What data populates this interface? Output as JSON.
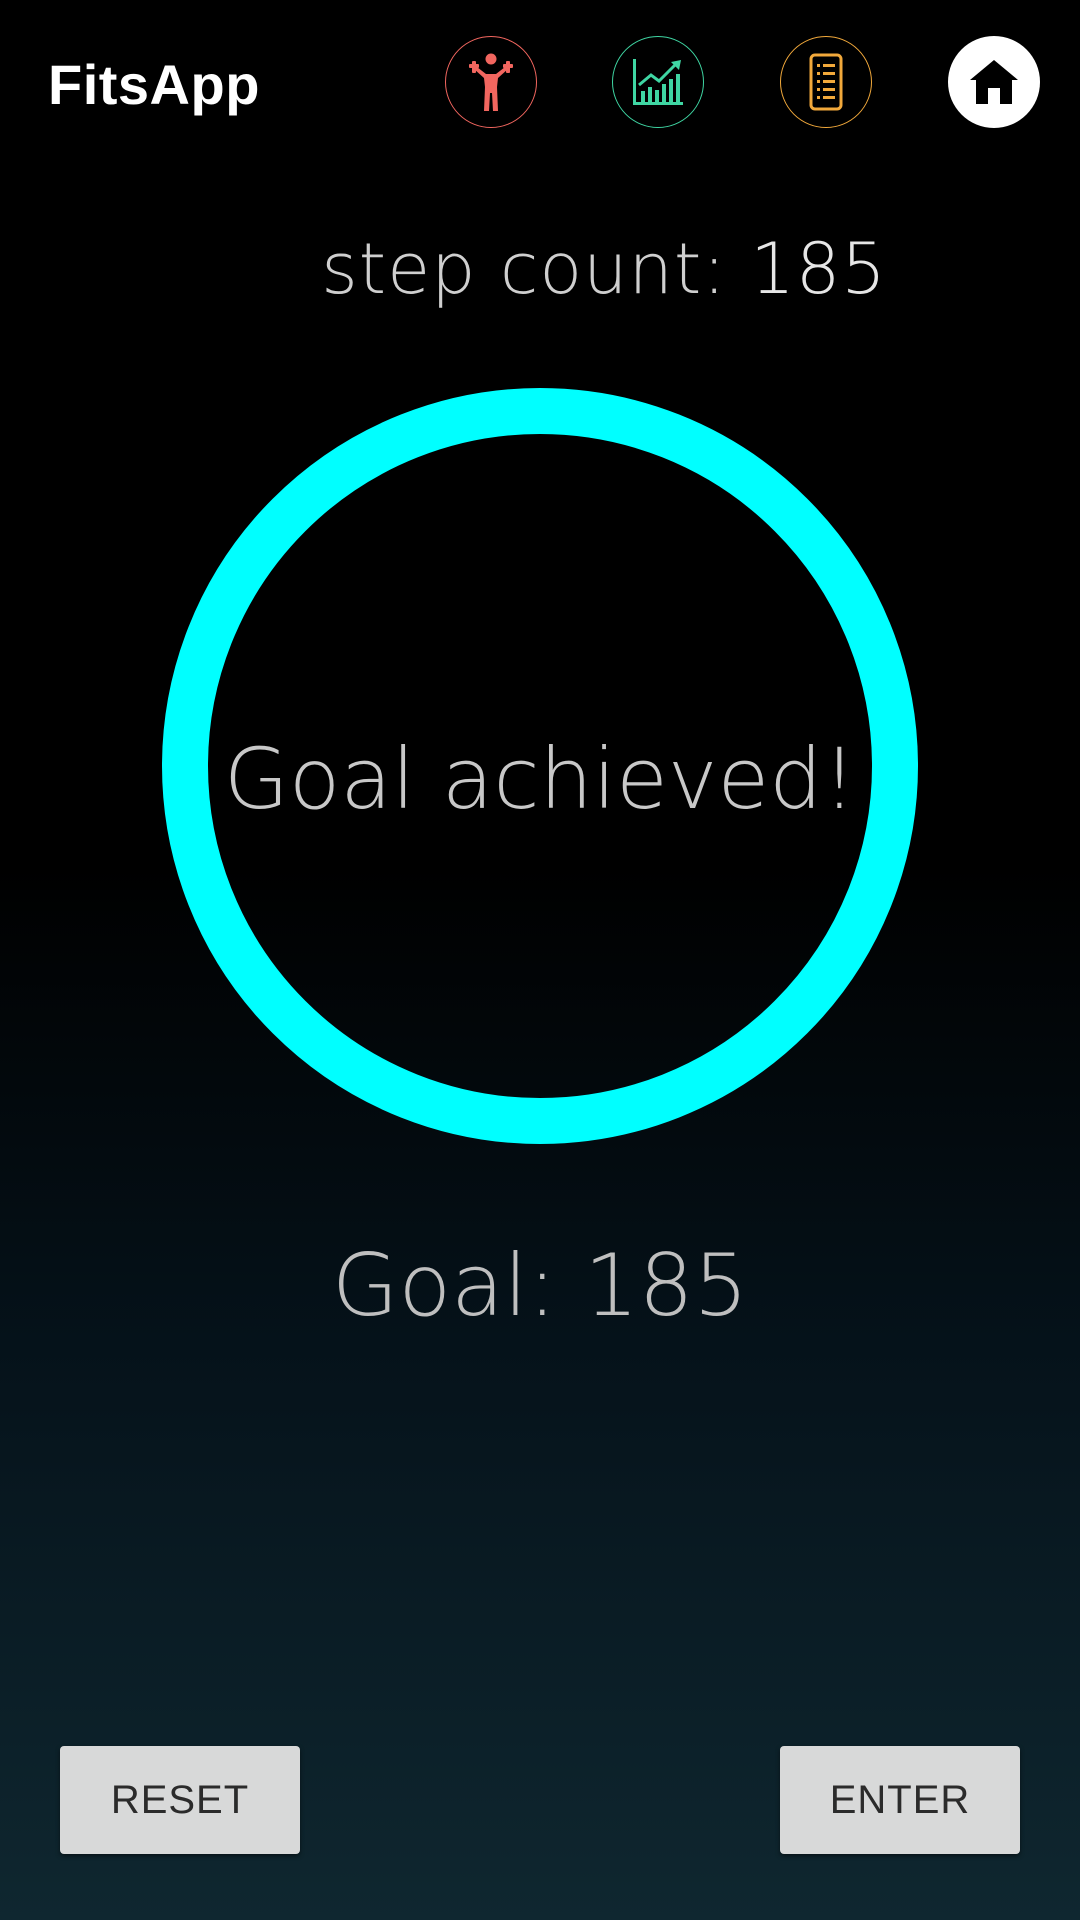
{
  "app": {
    "title": "FitsApp"
  },
  "nav": {
    "items": [
      {
        "icon": "workout-person-icon",
        "color": "#f2665f"
      },
      {
        "icon": "stats-chart-icon",
        "color": "#3fd6a3"
      },
      {
        "icon": "list-document-icon",
        "color": "#f2a93b"
      },
      {
        "icon": "home-icon",
        "color": "#ffffff",
        "active": true
      }
    ]
  },
  "steps": {
    "label": "step count: ",
    "value": "185"
  },
  "progress": {
    "message": "Goal achieved!",
    "ring_color": "#00ffff",
    "fraction": 1.0
  },
  "goal": {
    "text": "Goal: 185"
  },
  "buttons": {
    "reset_label": "RESET",
    "enter_label": "ENTER"
  }
}
